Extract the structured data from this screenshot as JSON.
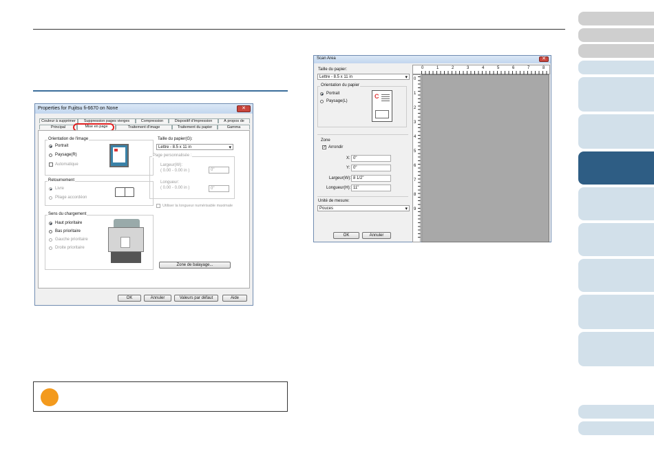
{
  "left_dialog": {
    "title": "Properties for Fujitsu fi-6670 on None",
    "tabs_row1": [
      "Couleur à supprimer",
      "Suppression pages vierges",
      "Compression",
      "Dispositif d'impression",
      "À propos de"
    ],
    "tabs_row2": [
      "Principal",
      "Mise en page",
      "Traitement d'image",
      "Traitement du papier",
      "Gamma"
    ],
    "orientation_label": "Orientation de l'image",
    "portrait": "Portrait",
    "paysage": "Paysage(R)",
    "automatique": "Automatique",
    "retournement": "Retournement",
    "livre": "Livre",
    "pliage": "Pliage accordéon",
    "sens": "Sens du chargement",
    "haut": "Haut prioritaire",
    "bas": "Bas prioritaire",
    "gauche": "Gauche prioritaire",
    "droite": "Droite prioritaire",
    "taille_label": "Taille du papier(G):",
    "taille_value": "Lettre - 8.5 x 11 in",
    "page_perso": "Page personnalisée :",
    "largeur": "Largeur(W):",
    "largeur_range": "( 0.00 - 0.00 in )",
    "largeur_val": "0\"",
    "longueur": "Longueur:",
    "longueur_range": "( 0.00 - 0.00 in )",
    "longueur_val": "0\"",
    "utiliser": "Utiliser la longueur numérisable maximale",
    "zone_btn": "Zone de balayage...",
    "ok": "OK",
    "annuler": "Annuler",
    "defaut": "Valeurs par défaut",
    "aide": "Aide"
  },
  "scan_area": {
    "title": "Scan Area",
    "taille_label": "Taille du papier:",
    "taille_value": "Lettre - 8.5 x 11 in",
    "orientation": "Orientation du papier",
    "portrait": "Portrait",
    "paysage": "Paysage(L)",
    "zone": "Zone",
    "arrondir": "Arrondir",
    "x_label": "X:",
    "x_val": "0\"",
    "y_label": "Y:",
    "y_val": "0\"",
    "largeur_label": "Largeur(W):",
    "largeur_val": "8 1/2\"",
    "longueur_label": "Longueur(H):",
    "longueur_val": "11\"",
    "unite_label": "Unité de mesure:",
    "unite_value": "Pouces",
    "ok": "OK",
    "annuler": "Annuler",
    "ruler_top": [
      "0",
      "1",
      "2",
      "3",
      "4",
      "5",
      "6",
      "7",
      "8"
    ],
    "ruler_left": [
      "0",
      "1",
      "2",
      "3",
      "4",
      "5",
      "6",
      "7",
      "8",
      "9"
    ]
  },
  "colors": {
    "accent": "#3a6d9a",
    "side_active": "#2e5d84",
    "orange": "#f39a1d"
  }
}
